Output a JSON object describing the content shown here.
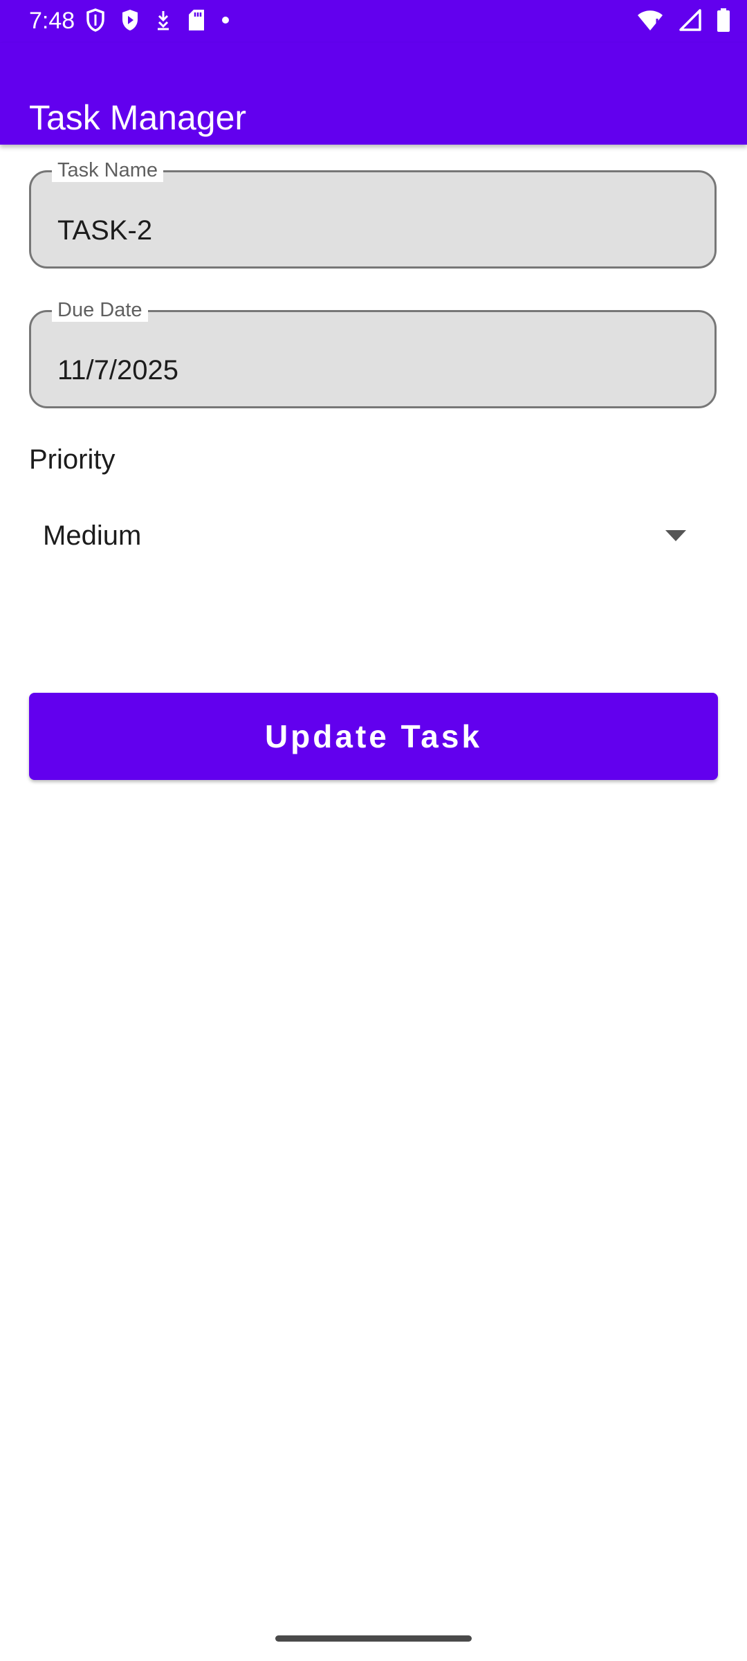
{
  "status_bar": {
    "time": "7:48",
    "icons_left": [
      "shield-icon",
      "play-protect-icon",
      "download-icon",
      "sd-card-icon",
      "dot-icon"
    ],
    "icons_right": [
      "wifi-icon",
      "signal-icon",
      "battery-icon"
    ],
    "background": "#6200ee"
  },
  "app_bar": {
    "title": "Task Manager",
    "background": "#6200ee"
  },
  "form": {
    "task_name": {
      "label": "Task Name",
      "value": "TASK-2"
    },
    "due_date": {
      "label": "Due Date",
      "value": "11/7/2025"
    },
    "priority": {
      "label": "Priority",
      "selected": "Medium"
    },
    "submit_label": "Update Task",
    "accent": "#6200ee"
  }
}
